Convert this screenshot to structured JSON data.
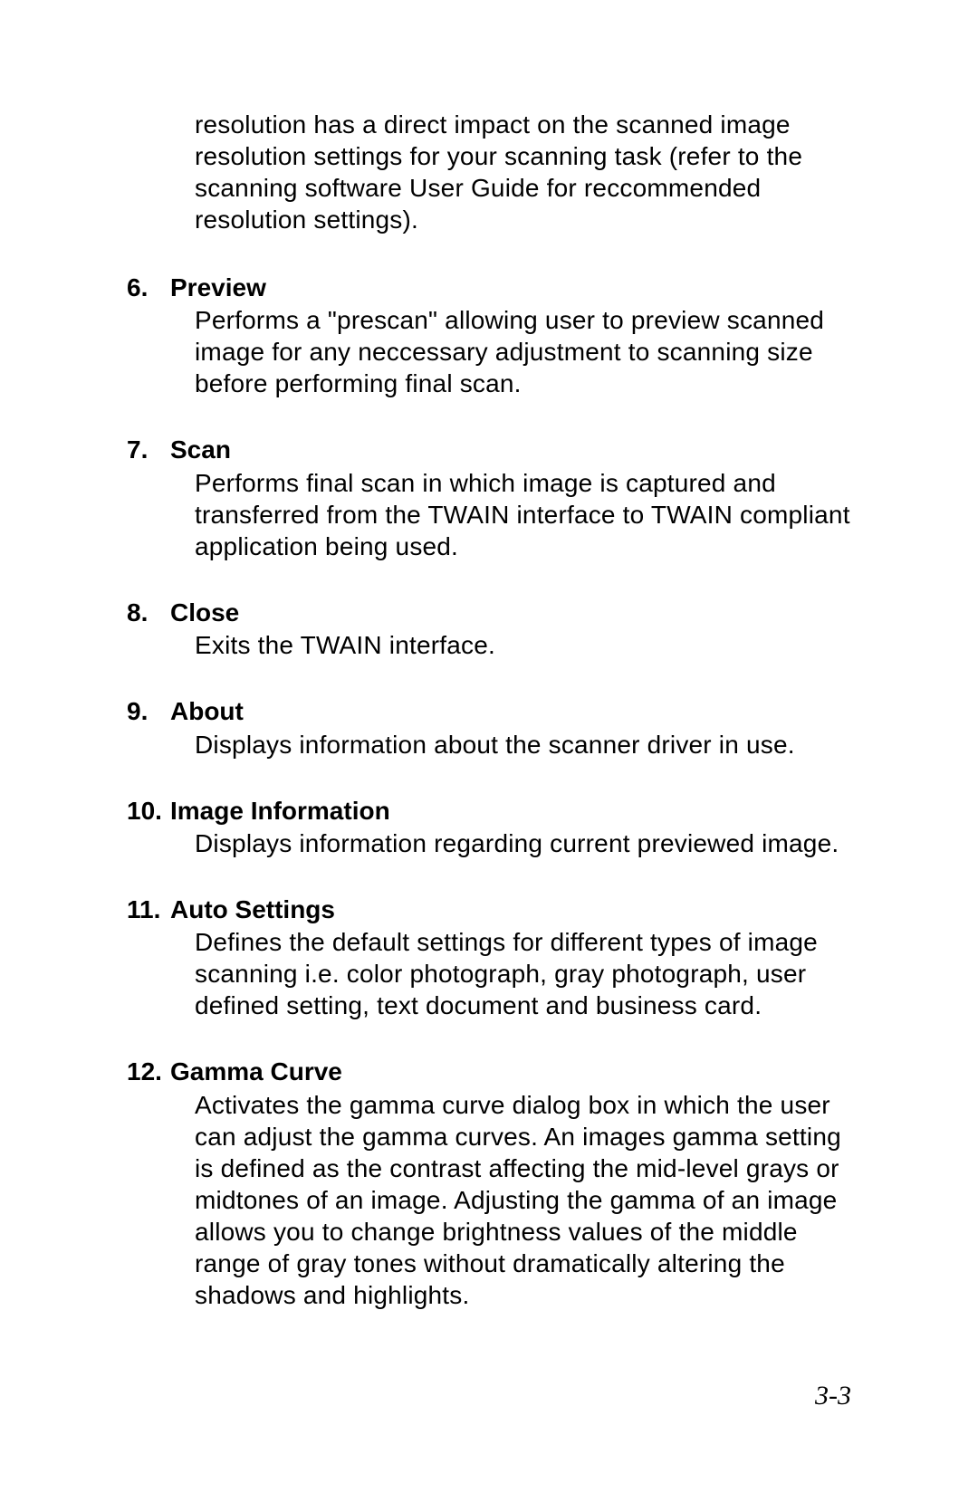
{
  "intro": "resolution has a direct impact on the scanned image resolution settings for your scanning task (refer to the scanning software User Guide for reccommended resolution settings).",
  "items": [
    {
      "num": "6.",
      "title": "Preview",
      "body": "Performs a \"prescan\" allowing user to preview scanned image for any neccessary adjustment to scanning size before performing final scan."
    },
    {
      "num": "7.",
      "title": "Scan",
      "body": "Performs final scan in which image is captured and transferred from the TWAIN interface to TWAIN compliant application being used."
    },
    {
      "num": "8.",
      "title": "Close",
      "body": "Exits the TWAIN interface."
    },
    {
      "num": "9.",
      "title": "About",
      "body": "Displays information about the scanner driver in use."
    },
    {
      "num": "10.",
      "title": "Image Information",
      "body": "Displays information regarding current previewed image."
    },
    {
      "num": "11.",
      "title": "Auto Settings",
      "body": "Defines the default settings for different types of image scanning i.e. color photograph, gray photograph, user defined setting, text document and business card."
    },
    {
      "num": "12.",
      "title": "Gamma Curve",
      "body": "Activates the gamma curve dialog box in which the user can adjust the gamma curves. An images gamma setting is defined as the contrast affecting the mid-level grays or midtones of an image. Adjusting the gamma of an image allows you to change brightness values of the middle range of gray tones without dramatically altering the shadows and highlights."
    }
  ],
  "page_number": "3-3"
}
